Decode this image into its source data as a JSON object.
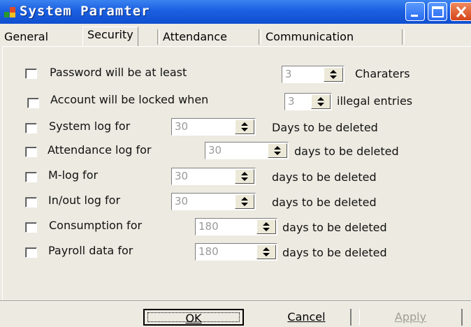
{
  "window": {
    "title": "System Paramter"
  },
  "tabs": [
    {
      "label": "General"
    },
    {
      "label": "Security"
    },
    {
      "label": "Attendance"
    },
    {
      "label": "Communication"
    }
  ],
  "active_tab": "Security",
  "rows": [
    {
      "label": "Password will be at least",
      "value": "3",
      "suffix": "Charaters",
      "checked": false
    },
    {
      "label": "Account will be locked when",
      "value": "3",
      "suffix": "illegal entries",
      "checked": false
    },
    {
      "label": "System log for",
      "value": "30",
      "suffix": "Days to be deleted",
      "checked": false
    },
    {
      "label": "Attendance log for",
      "value": "30",
      "suffix": "days to be deleted",
      "checked": false
    },
    {
      "label": "M-log for",
      "value": "30",
      "suffix": "days to be deleted",
      "checked": false
    },
    {
      "label": "In/out log for",
      "value": "30",
      "suffix": "days to be deleted",
      "checked": false
    },
    {
      "label": "Consumption  for",
      "value": "180",
      "suffix": "days to be deleted",
      "checked": false
    },
    {
      "label": "Payroll data for",
      "value": "180",
      "suffix": "days to be deleted",
      "checked": false
    }
  ],
  "buttons": {
    "ok": "OK",
    "cancel": "Cancel",
    "apply": "Apply"
  },
  "colors": {
    "titlebar": "#1b5fe0",
    "panel": "#eceae1",
    "close_button": "#d5431a"
  }
}
